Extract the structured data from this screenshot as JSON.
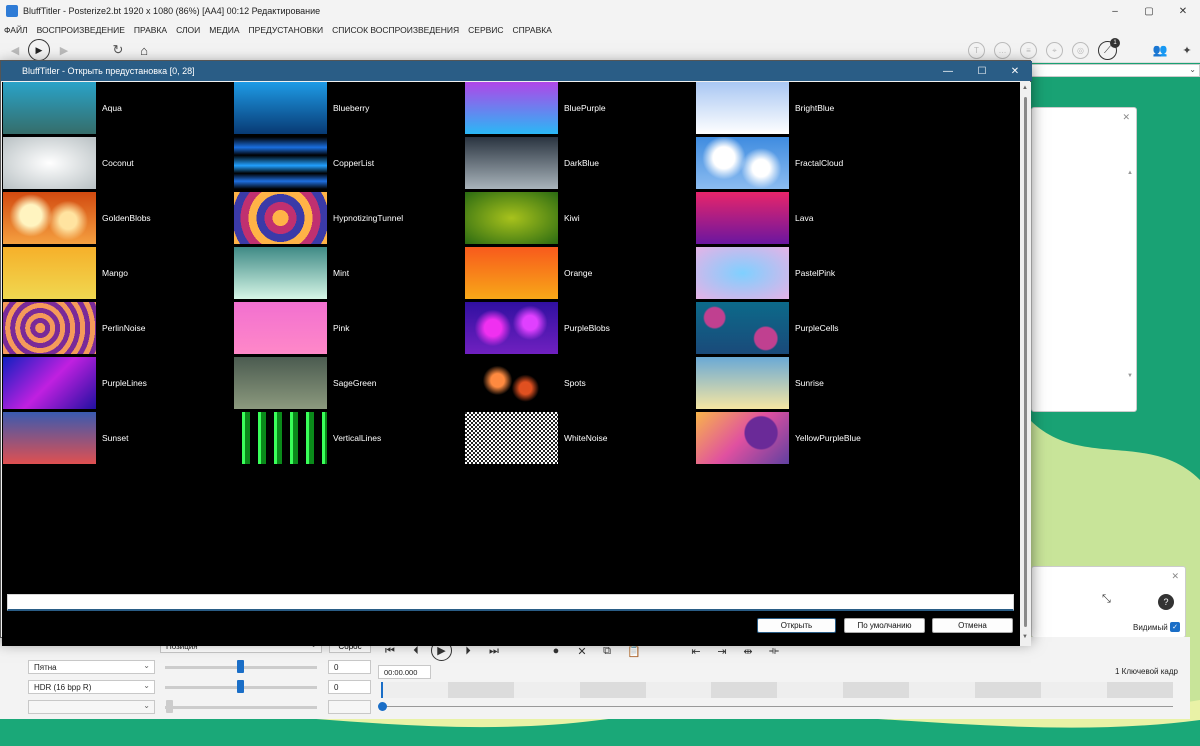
{
  "window": {
    "title": "BluffTitler - Posterize2.bt 1920 x 1080 (86%) [AA4] 00:12 Редактирование",
    "minimize": "–",
    "maximize": "▢",
    "close": "✕"
  },
  "menu": [
    "ФАЙЛ",
    "ВОСПРОИЗВЕДЕНИЕ",
    "ПРАВКА",
    "СЛОИ",
    "МЕДИА",
    "ПРЕДУСТАНОВКИ",
    "СПИСОК ВОСПРОИЗВЕДЕНИЯ",
    "СЕРВИС",
    "СПРАВКА"
  ],
  "toolbar": {
    "back_icon": "◀",
    "play_icon": "▶",
    "forward_icon": "▶",
    "refresh_icon": "↻",
    "home_icon": "⌂",
    "notif_count": "1",
    "help_icon": "?"
  },
  "dialog": {
    "title": "BluffTitler - Открыть предустановка [0, 28]",
    "minimize": "—",
    "maximize": "☐",
    "close": "✕",
    "search_value": "",
    "buttons": {
      "open": "Открыть",
      "default": "По умолчанию",
      "cancel": "Отмена"
    },
    "presets": [
      [
        "Aqua",
        "Blueberry",
        "BluePurple",
        "BrightBlue"
      ],
      [
        "Coconut",
        "CopperList",
        "DarkBlue",
        "FractalCloud"
      ],
      [
        "GoldenBlobs",
        "HypnotizingTunnel",
        "Kiwi",
        "Lava"
      ],
      [
        "Mango",
        "Mint",
        "Orange",
        "PastelPink"
      ],
      [
        "PerlinNoise",
        "Pink",
        "PurpleBlobs",
        "PurpleCells"
      ],
      [
        "PurpleLines",
        "SageGreen",
        "Spots",
        "Sunrise"
      ],
      [
        "Sunset",
        "VerticalLines",
        "WhiteNoise",
        "YellowPurpleBlue"
      ]
    ]
  },
  "bottom": {
    "property_select": "Позиция",
    "reset": "Сброс",
    "layer_select": "Пятна",
    "format_select": "HDR (16 bpp R)",
    "value1": "0",
    "value2": "0",
    "time": "00:00.000",
    "keyframes": "1 Ключевой кадр",
    "visible_label": "Видимый"
  },
  "colors": {
    "accent": "#2a5d86",
    "blue": "#1a6ec7"
  }
}
